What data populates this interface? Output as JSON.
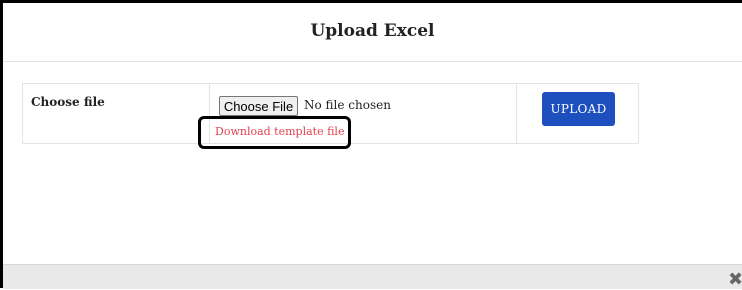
{
  "modal": {
    "title": "Upload Excel"
  },
  "form": {
    "choose_file_label": "Choose file",
    "file_button_label": "Choose File",
    "file_status": "No file chosen",
    "download_template_link": "Download template file",
    "upload_button_label": "UPLOAD"
  },
  "footer": {
    "close_icon": "close-icon"
  },
  "colors": {
    "upload_button": "#1d4fbf",
    "download_link": "#e0424f",
    "footer_bg": "#e9e9e9"
  }
}
